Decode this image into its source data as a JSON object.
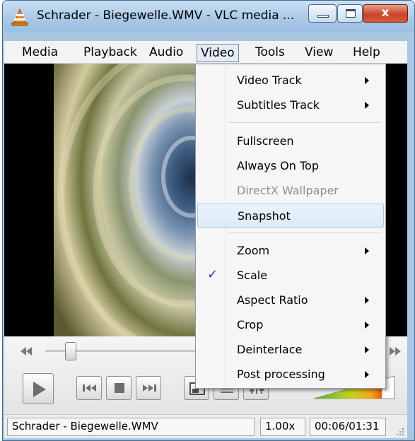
{
  "window": {
    "title": "Schrader - Biegewelle.WMV - VLC media ...",
    "close_glyph": "x"
  },
  "menubar": {
    "items": [
      "Media",
      "Playback",
      "Audio",
      "Video",
      "Tools",
      "View",
      "Help"
    ],
    "active": "Video"
  },
  "video_menu": {
    "items": [
      {
        "label": "Video Track",
        "submenu": true
      },
      {
        "label": "Subtitles Track",
        "submenu": true
      },
      {
        "label": "Fullscreen"
      },
      {
        "label": "Always On Top"
      },
      {
        "label": "DirectX Wallpaper",
        "disabled": true
      },
      {
        "label": "Snapshot",
        "highlighted": true
      },
      {
        "label": "Zoom",
        "submenu": true
      },
      {
        "label": "Scale",
        "checked": true
      },
      {
        "label": "Aspect Ratio",
        "submenu": true
      },
      {
        "label": "Crop",
        "submenu": true
      },
      {
        "label": "Deinterlace",
        "submenu": true
      },
      {
        "label": "Post processing",
        "submenu": true
      }
    ]
  },
  "controls": {
    "seek_position_fraction": 0.17,
    "buttons": [
      "play-icon",
      "prev-icon",
      "stop-icon",
      "next-icon",
      "fullscreen-icon",
      "playlist-icon",
      "equalizer-icon"
    ],
    "volume_level": 0.85
  },
  "statusbar": {
    "filename": "Schrader - Biegewelle.WMV",
    "speed": "1.00x",
    "time": "00:06/01:31"
  },
  "colors": {
    "frame": "#a9c6e3",
    "close_button": "#c8452a",
    "menu_highlight": "#dbeaf8",
    "check": "#1f3f8f"
  }
}
